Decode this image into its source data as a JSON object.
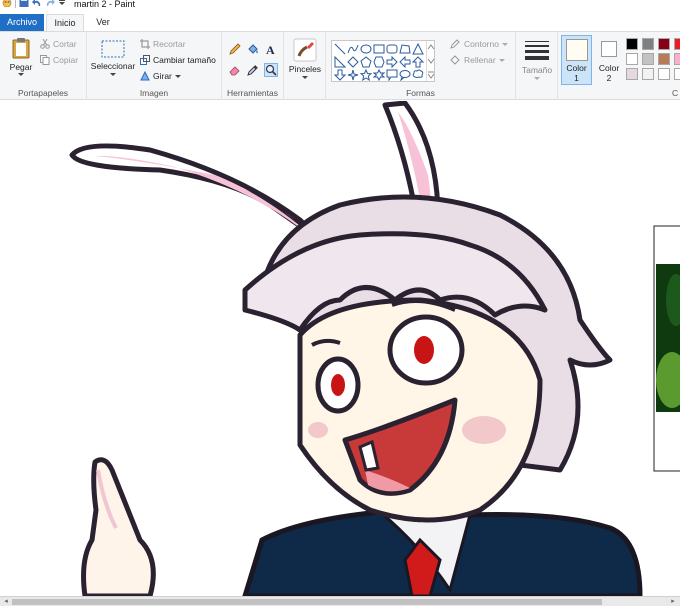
{
  "window": {
    "title": "martin 2 - Paint"
  },
  "tabs": [
    {
      "label": "Archivo"
    },
    {
      "label": "Inicio"
    },
    {
      "label": "Ver"
    }
  ],
  "clipboard": {
    "paste_label": "Pegar",
    "cut_label": "Cortar",
    "copy_label": "Copiar",
    "group_label": "Portapapeles"
  },
  "image": {
    "select_label": "Seleccionar",
    "crop_label": "Recortar",
    "resize_label": "Cambiar tamaño",
    "rotate_label": "Girar",
    "group_label": "Imagen"
  },
  "tools": {
    "group_label": "Herramientas"
  },
  "brushes": {
    "label": "Pinceles"
  },
  "shapes": {
    "outline_label": "Contorno",
    "fill_label": "Rellenar",
    "group_label": "Formas"
  },
  "size": {
    "label": "Tamaño"
  },
  "colors": {
    "color1_label": "Color",
    "color1_number": "1",
    "color2_label": "Color",
    "color2_number": "2",
    "group_label": "C",
    "color1": "#fffcf2",
    "color2": "#ffffff",
    "palette_row1": [
      "#000000",
      "#7f7f7f",
      "#880015",
      "#ed1c24"
    ],
    "palette_row2": [
      "#ffffff",
      "#c3c3c3",
      "#b97a57",
      "#ffaec9"
    ],
    "palette_row3": [
      "#e6d8df",
      "#f2f2f2",
      "#ffffff",
      "#ffffff"
    ]
  },
  "accent": {
    "file_tab": "#1e6fc5",
    "selection": "#cce4f7"
  }
}
